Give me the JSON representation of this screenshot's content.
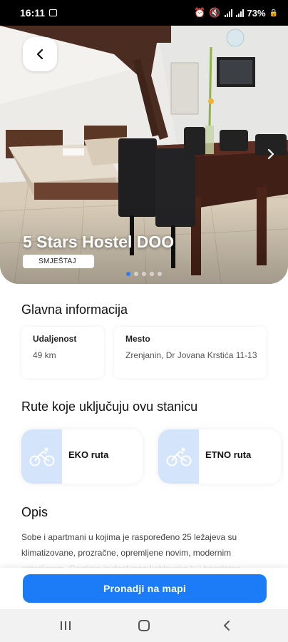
{
  "status_bar": {
    "time": "16:11",
    "battery": "73%"
  },
  "hero": {
    "title": "5 Stars Hostel DOO",
    "category_tag": "SMJEŠTAJ",
    "slide_count": 5,
    "active_slide": 1
  },
  "main_info": {
    "heading": "Glavna informacija",
    "distance": {
      "label": "Udaljenost",
      "value": "49 km"
    },
    "location": {
      "label": "Mesto",
      "value": "Zrenjanin, Dr Jovana Krstića 11-13"
    }
  },
  "routes": {
    "heading": "Rute koje uključuju ovu stanicu",
    "items": [
      {
        "label": "EKO ruta",
        "icon": "bicycle-icon"
      },
      {
        "label": "ETNO ruta",
        "icon": "bicycle-icon"
      }
    ]
  },
  "description": {
    "heading": "Opis",
    "text": "Sobe i apartmani u kojima je raspoređeno 25 ležajeva su klimatizovane, prozračne, opremljene novim, modernim enterijerom. Gostima je dostupna kablovska tv i besplatan"
  },
  "actions": {
    "find_on_map": "Pronadji na mapi"
  },
  "colors": {
    "accent": "#1c7cf7",
    "route_icon_bg": "#d4e4fb"
  }
}
